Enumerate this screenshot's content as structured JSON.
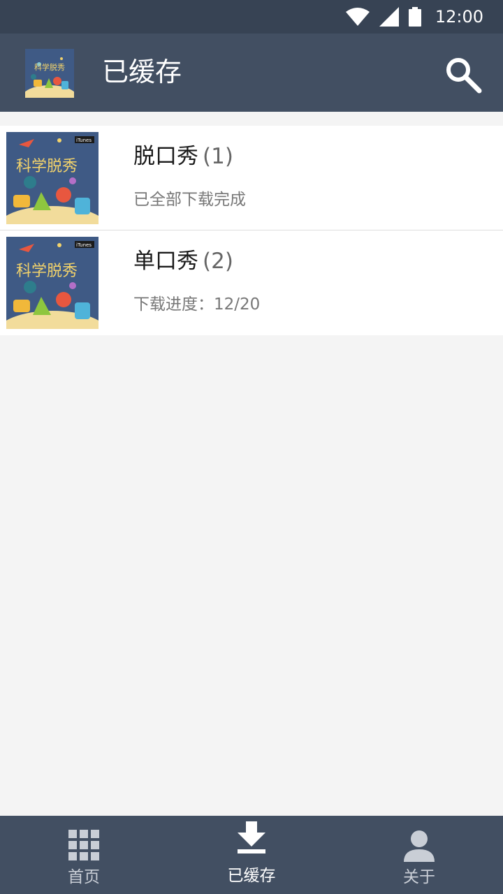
{
  "status_bar": {
    "time": "12:00",
    "icons": [
      "wifi-icon",
      "signal-icon",
      "battery-icon"
    ]
  },
  "app_bar": {
    "title": "已缓存",
    "logo_icon": "podcast-logo",
    "action_icon": "search-icon"
  },
  "list": {
    "items": [
      {
        "title": "脱口秀",
        "count": "(1)",
        "subtitle": "已全部下载完成",
        "thumb_icon": "podcast-cover"
      },
      {
        "title": "单口秀",
        "count": "(2)",
        "subtitle": "下载进度：12/20",
        "thumb_icon": "podcast-cover"
      }
    ]
  },
  "bottom_nav": {
    "items": [
      {
        "label": "首页",
        "icon": "grid-icon",
        "active": false
      },
      {
        "label": "已缓存",
        "icon": "download-icon",
        "active": true
      },
      {
        "label": "关于",
        "icon": "person-icon",
        "active": false
      }
    ]
  },
  "colors": {
    "status_bar_bg": "#374354",
    "app_bar_bg": "#424f62",
    "nav_bg": "#424f62",
    "page_bg": "#f4f4f4",
    "nav_inactive": "#c9ced6"
  }
}
